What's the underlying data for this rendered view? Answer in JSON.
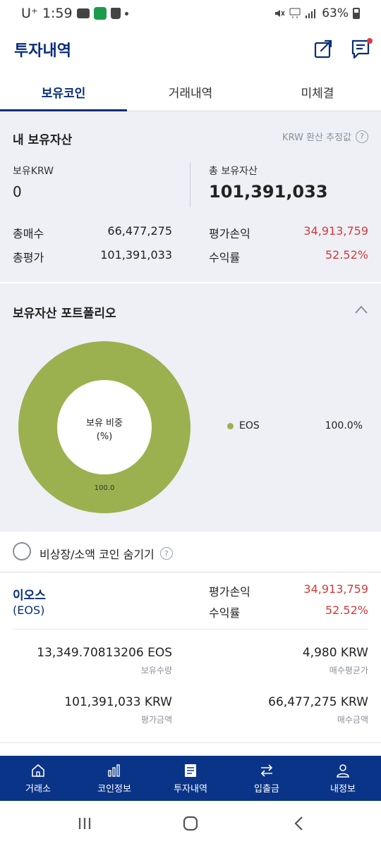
{
  "status_bar": {
    "carrier": "U⁺",
    "time": "1:59",
    "battery": "63%"
  },
  "header": {
    "title": "투자내역"
  },
  "tabs": [
    {
      "label": "보유코인",
      "active": true
    },
    {
      "label": "거래내역",
      "active": false
    },
    {
      "label": "미체결",
      "active": false
    }
  ],
  "summary": {
    "title": "내 보유자산",
    "krw_estimate": "KRW 환산 추정값",
    "holding_krw_label": "보유KRW",
    "holding_krw_value": "0",
    "total_assets_label": "총 보유자산",
    "total_assets_value": "101,391,033",
    "total_buy_label": "총매수",
    "total_buy_value": "66,477,275",
    "total_eval_label": "총평가",
    "total_eval_value": "101,391,033",
    "pnl_label": "평가손익",
    "pnl_value": "34,913,759",
    "return_label": "수익률",
    "return_value": "52.52%"
  },
  "portfolio": {
    "title": "보유자산 포트폴리오",
    "center_label_1": "보유 비중",
    "center_label_2": "(%)",
    "slice_label": "100.0",
    "legend": [
      {
        "name": "EOS",
        "pct": "100.0%",
        "color": "#9bb14f"
      }
    ]
  },
  "chart_data": {
    "type": "pie",
    "categories": [
      "EOS"
    ],
    "values": [
      100.0
    ],
    "title": "보유 비중 (%)"
  },
  "hide_small": {
    "label": "비상장/소액 코인 숨기기"
  },
  "coin": {
    "name": "이오스",
    "symbol": "(EOS)",
    "pnl_label": "평가손익",
    "pnl_value": "34,913,759",
    "return_label": "수익률",
    "return_value": "52.52%",
    "quantity_value": "13,349.70813206 EOS",
    "quantity_label": "보유수량",
    "avg_price_value": "4,980 KRW",
    "avg_price_label": "매수평균가",
    "eval_amount_value": "101,391,033 KRW",
    "eval_amount_label": "평가금액",
    "buy_amount_value": "66,477,275 KRW",
    "buy_amount_label": "매수금액"
  },
  "bottom_nav": [
    {
      "label": "거래소",
      "icon": "home-icon"
    },
    {
      "label": "코인정보",
      "icon": "chart-icon"
    },
    {
      "label": "투자내역",
      "icon": "document-icon"
    },
    {
      "label": "입출금",
      "icon": "transfer-icon"
    },
    {
      "label": "내정보",
      "icon": "person-icon"
    }
  ],
  "colors": {
    "brand_navy": "#0a2d7a",
    "nav_bg": "#0a3487",
    "positive_red": "#d23b3b",
    "donut_green": "#9bb14f"
  }
}
